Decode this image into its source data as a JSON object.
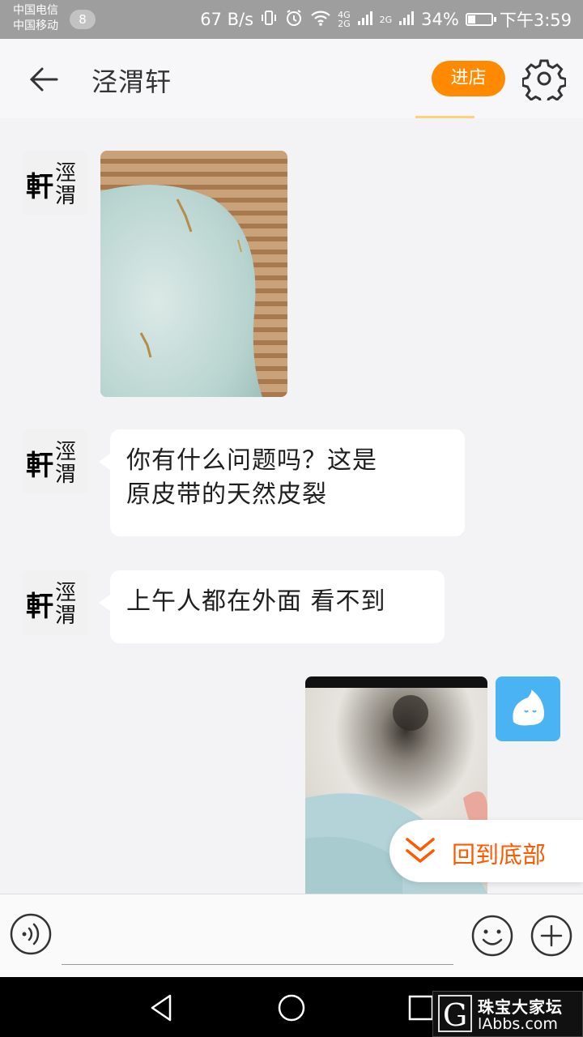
{
  "status_bar": {
    "carrier_1": "中国电信",
    "carrier_2": "中国移动",
    "notification_count": "8",
    "network_speed": "67 B/s",
    "sig_4g": "4G",
    "sig_2g_a": "2G",
    "sig_2g_b": "2G",
    "battery": "34%",
    "battery_level": 0.34,
    "time": "下午3:59"
  },
  "header": {
    "title": "泾渭轩",
    "enter_store_label": "进店"
  },
  "messages": [
    {
      "sender": "shop",
      "type": "image"
    },
    {
      "sender": "shop",
      "type": "text",
      "lines": [
        "你有什么问题吗？这是",
        "原皮带的天然皮裂"
      ]
    },
    {
      "sender": "shop",
      "type": "text",
      "lines": [
        "上午人都在外面 看不到"
      ]
    },
    {
      "sender": "me",
      "type": "image"
    }
  ],
  "avatar": {
    "seal_text_1": "涇",
    "seal_text_2": "渭",
    "seal_text_3": "軒"
  },
  "back_to_bottom_label": "回到底部",
  "input": {
    "placeholder": ""
  },
  "watermark": {
    "logo_letter": "G",
    "name_cn": "珠宝大家坛",
    "name_en": "lAbbs.com"
  },
  "colors": {
    "accent": "#ff8a00",
    "back_bottom": "#ff5a00",
    "self_avatar": "#4ab3f4"
  }
}
